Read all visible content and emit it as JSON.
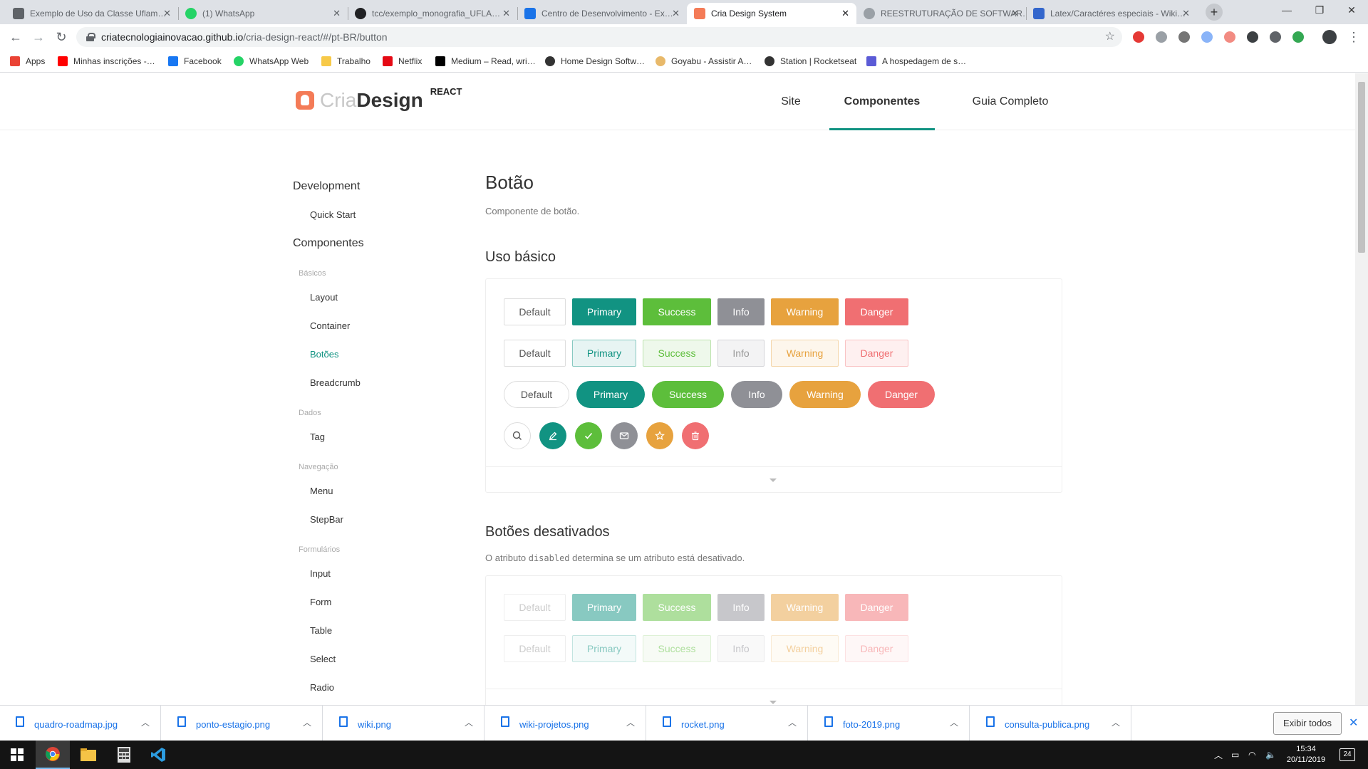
{
  "browser": {
    "tabs": [
      {
        "title": "Exemplo de Uso da Classe Uflam…",
        "color": "#5f6368"
      },
      {
        "title": "(1) WhatsApp",
        "color": "#25d366"
      },
      {
        "title": "tcc/exemplo_monografia_UFLA…",
        "color": "#202124"
      },
      {
        "title": "Centro de Desenvolvimento - Ex…",
        "color": "#1a73e8"
      },
      {
        "title": "Cria Design System",
        "color": "#f47b57"
      },
      {
        "title": "REESTRUTURAÇÃO DE SOFTWAR…",
        "color": "#9aa0a6"
      },
      {
        "title": "Latex/Caractéres especiais - Wiki…",
        "color": "#3366cc"
      }
    ],
    "url_host": "criatecnologiainovacao.github.io",
    "url_path": "/cria-design-react/#/pt-BR/button",
    "bookmarks": [
      {
        "label": "Apps",
        "color": "#ea4335"
      },
      {
        "label": "Minhas inscrições -…",
        "color": "#ff0000"
      },
      {
        "label": "Facebook",
        "color": "#1877f2"
      },
      {
        "label": "WhatsApp Web",
        "color": "#25d366"
      },
      {
        "label": "Trabalho",
        "color": "#f7c948"
      },
      {
        "label": "Netflix",
        "color": "#e50914"
      },
      {
        "label": "Medium – Read, wri…",
        "color": "#000000"
      },
      {
        "label": "Home Design Softw…",
        "color": "#333333"
      },
      {
        "label": "Goyabu - Assistir A…",
        "color": "#e8b96a"
      },
      {
        "label": "Station | Rocketseat",
        "color": "#333333"
      },
      {
        "label": "A hospedagem de s…",
        "color": "#5b5bd6"
      }
    ]
  },
  "site": {
    "logo_cria": "Cria",
    "logo_design": "Design",
    "logo_react": "REACT",
    "nav": [
      "Site",
      "Componentes",
      "Guia Completo"
    ]
  },
  "sidebar": {
    "development": "Development",
    "quick_start": "Quick Start",
    "componentes": "Componentes",
    "basicos": "Básicos",
    "layout": "Layout",
    "container": "Container",
    "botoes": "Botões",
    "breadcrumb": "Breadcrumb",
    "dados": "Dados",
    "tag": "Tag",
    "navegacao": "Navegação",
    "menu": "Menu",
    "stepbar": "StepBar",
    "formularios": "Formulários",
    "input": "Input",
    "form": "Form",
    "table": "Table",
    "select": "Select",
    "radio": "Radio"
  },
  "content": {
    "title": "Botão",
    "description": "Componente de botão.",
    "basic_title": "Uso básico",
    "disabled_title": "Botões desativados",
    "disabled_desc_pre": "O atributo",
    "disabled_desc_code": "disabled",
    "disabled_desc_post": "determina se um atributo está desativado.",
    "buttons": [
      "Default",
      "Primary",
      "Success",
      "Info",
      "Warning",
      "Danger"
    ],
    "icon_buttons": [
      "search-icon",
      "edit-icon",
      "check-icon",
      "message-icon",
      "star-icon",
      "delete-icon"
    ]
  },
  "downloads": {
    "files": [
      "quadro-roadmap.jpg",
      "ponto-estagio.png",
      "wiki.png",
      "wiki-projetos.png",
      "rocket.png",
      "foto-2019.png",
      "consulta-publica.png"
    ],
    "show_all": "Exibir todos"
  },
  "taskbar": {
    "time": "15:34",
    "date": "20/11/2019",
    "notifications": "24"
  }
}
